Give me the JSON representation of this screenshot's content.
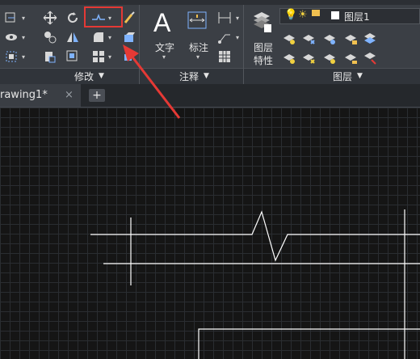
{
  "ribbon": {
    "panels": {
      "modify": {
        "title": "修改"
      },
      "annotation": {
        "title": "注释",
        "text_label": "文字",
        "dimension_label": "标注"
      },
      "layers": {
        "title": "图层",
        "properties_label_1": "图层",
        "properties_label_2": "特性",
        "current_layer": "图层1"
      }
    }
  },
  "document": {
    "tab_label": "rawing1*",
    "close_glyph": "×",
    "add_glyph": "+"
  },
  "colors": {
    "ribbon_bg": "#3b3f45",
    "canvas_bg": "#151515",
    "highlight": "#e53935",
    "arrow": "#e53935",
    "line": "#ffffff"
  }
}
